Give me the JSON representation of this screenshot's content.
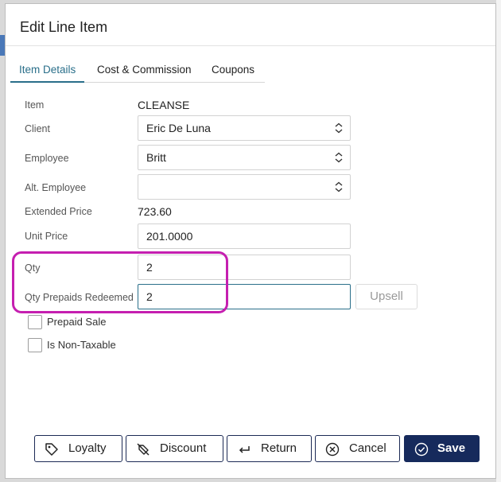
{
  "dialog": {
    "title": "Edit Line Item"
  },
  "tabs": [
    {
      "label": "Item Details"
    },
    {
      "label": "Cost & Commission"
    },
    {
      "label": "Coupons"
    }
  ],
  "form": {
    "item": {
      "label": "Item",
      "value": "CLEANSE"
    },
    "client": {
      "label": "Client",
      "value": "Eric De Luna"
    },
    "employee": {
      "label": "Employee",
      "value": "Britt"
    },
    "alt_employee": {
      "label": "Alt. Employee",
      "value": ""
    },
    "extended_price": {
      "label": "Extended Price",
      "value": "723.60"
    },
    "unit_price": {
      "label": "Unit Price",
      "value": "201.0000"
    },
    "qty": {
      "label": "Qty",
      "value": "2"
    },
    "qty_prepaids": {
      "label": "Qty Prepaids Redeemed",
      "value": "2"
    },
    "upsell_label": "Upsell",
    "prepaid_sale": {
      "label": "Prepaid Sale",
      "checked": false
    },
    "non_taxable": {
      "label": "Is Non-Taxable",
      "checked": false
    }
  },
  "footer": {
    "loyalty": "Loyalty",
    "discount": "Discount",
    "return": "Return",
    "cancel": "Cancel",
    "save": "Save"
  },
  "colors": {
    "accent": "#2a6f8a",
    "primary_button": "#162a5c",
    "highlight": "#c51fb0"
  },
  "icons": {
    "loyalty": "tag-icon",
    "discount": "no-tag-icon",
    "return": "return-arrow-icon",
    "cancel": "circle-x-icon",
    "save": "circle-check-icon"
  }
}
